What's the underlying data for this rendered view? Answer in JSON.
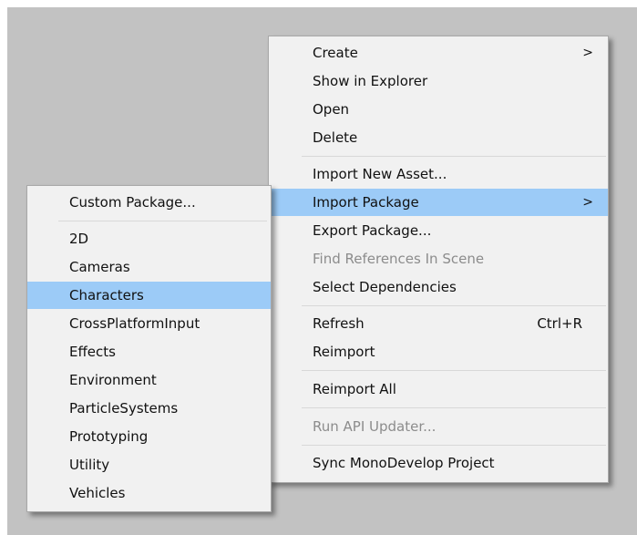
{
  "main_menu": {
    "create": "Create",
    "create_arrow": ">",
    "show_in_explorer": "Show in Explorer",
    "open": "Open",
    "delete": "Delete",
    "import_new_asset": "Import New Asset...",
    "import_package": "Import Package",
    "import_package_arrow": ">",
    "export_package": "Export Package...",
    "find_references": "Find References In Scene",
    "select_dependencies": "Select Dependencies",
    "refresh": "Refresh",
    "refresh_shortcut": "Ctrl+R",
    "reimport": "Reimport",
    "reimport_all": "Reimport All",
    "run_api_updater": "Run API Updater...",
    "sync_monodevelop": "Sync MonoDevelop Project"
  },
  "sub_menu": {
    "custom_package": "Custom Package...",
    "items": [
      "2D",
      "Cameras",
      "Characters",
      "CrossPlatformInput",
      "Effects",
      "Environment",
      "ParticleSystems",
      "Prototyping",
      "Utility",
      "Vehicles"
    ]
  },
  "colors": {
    "highlight": "#9ccbf7",
    "menu_background": "#f1f1f1",
    "backdrop": "#c2c2c2",
    "disabled_text": "#8c8c8c"
  }
}
